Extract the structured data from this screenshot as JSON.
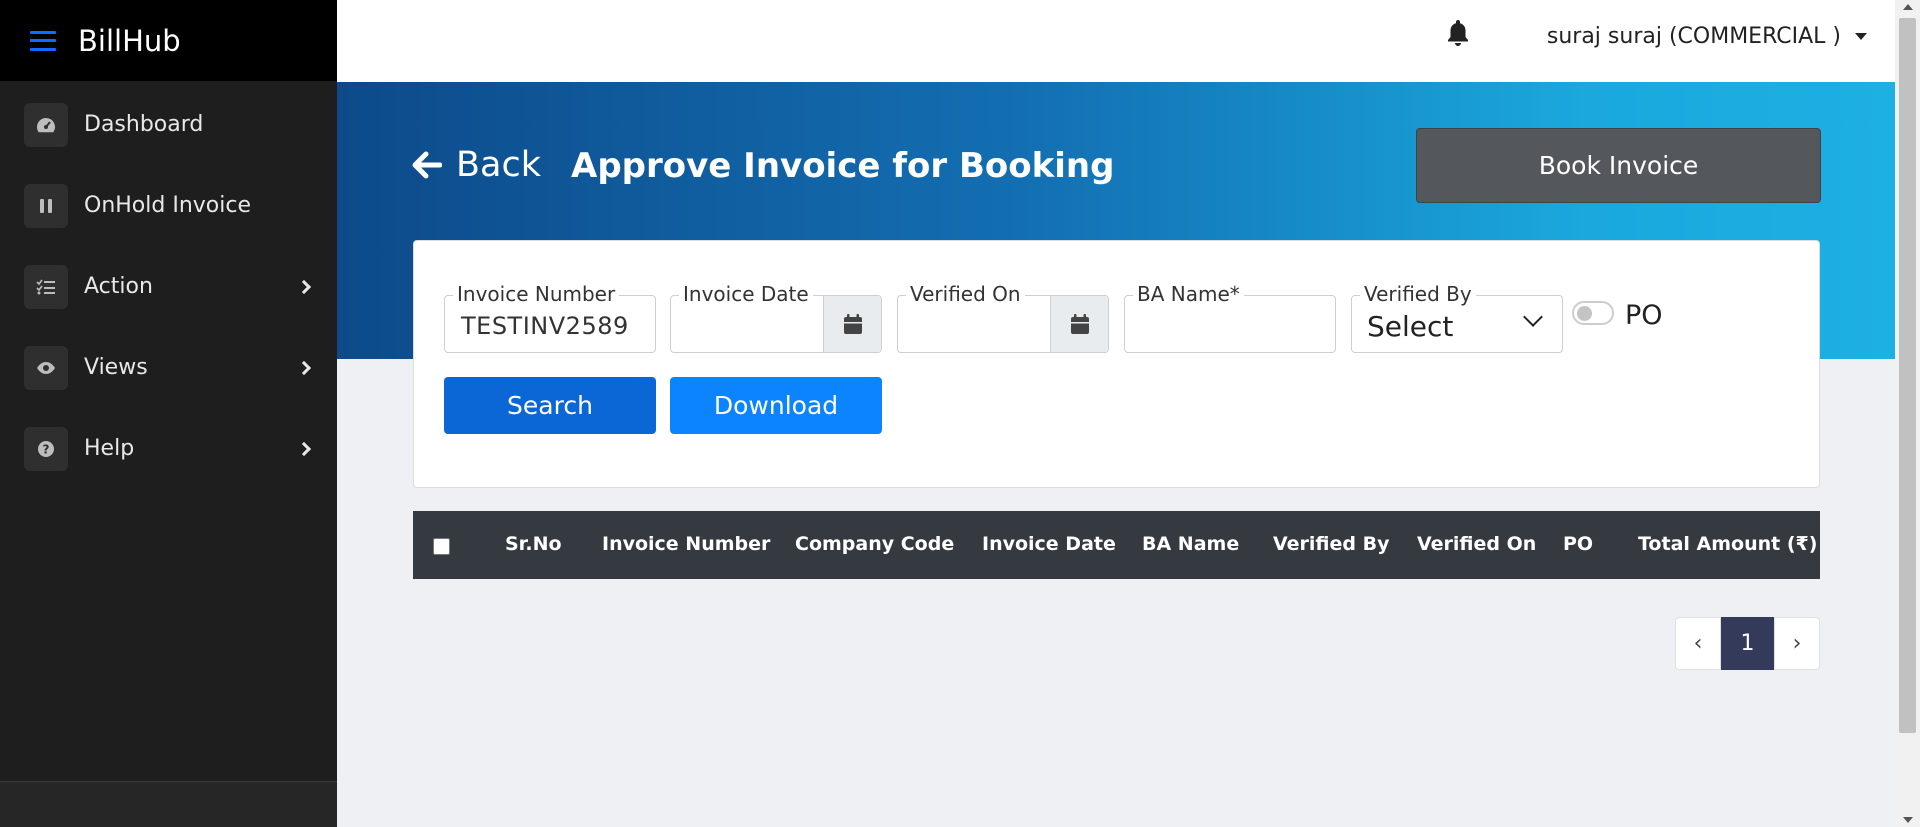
{
  "app": {
    "name": "BillHub"
  },
  "sidebar": {
    "items": [
      {
        "label": "Dashboard",
        "icon": "gauge-icon",
        "has_submenu": false
      },
      {
        "label": "OnHold Invoice",
        "icon": "pause-icon",
        "has_submenu": false
      },
      {
        "label": "Action",
        "icon": "checklist-icon",
        "has_submenu": true
      },
      {
        "label": "Views",
        "icon": "eye-icon",
        "has_submenu": true
      },
      {
        "label": "Help",
        "icon": "question-icon",
        "has_submenu": true
      }
    ]
  },
  "topbar": {
    "user_label": "suraj suraj (COMMERCIAL )"
  },
  "header": {
    "back_label": "Back",
    "title": "Approve Invoice for Booking",
    "book_button_label": "Book Invoice"
  },
  "filters": {
    "invoice_number": {
      "label": "Invoice Number",
      "value": "TESTINV2589"
    },
    "invoice_date": {
      "label": "Invoice Date",
      "value": ""
    },
    "verified_on": {
      "label": "Verified On",
      "value": ""
    },
    "ba_name": {
      "label": "BA Name*",
      "value": ""
    },
    "verified_by": {
      "label": "Verified By",
      "selected": "Select"
    },
    "po_toggle": {
      "label": "PO",
      "checked": false
    },
    "search_label": "Search",
    "download_label": "Download"
  },
  "table": {
    "columns": [
      "Sr.No",
      "Invoice Number",
      "Company Code",
      "Invoice Date",
      "BA Name",
      "Verified By",
      "Verified On",
      "PO",
      "Total Amount (₹)"
    ],
    "rows": []
  },
  "pagination": {
    "prev": "‹",
    "current": "1",
    "next": "›"
  },
  "colors": {
    "sidebar_bg": "#1e1e1e",
    "brand_accent": "#0d6efd",
    "search_button": "#0b67d6",
    "download_button": "#0d84ff",
    "book_button": "#54585d",
    "table_header": "#343a40",
    "active_page": "#343a5a"
  }
}
